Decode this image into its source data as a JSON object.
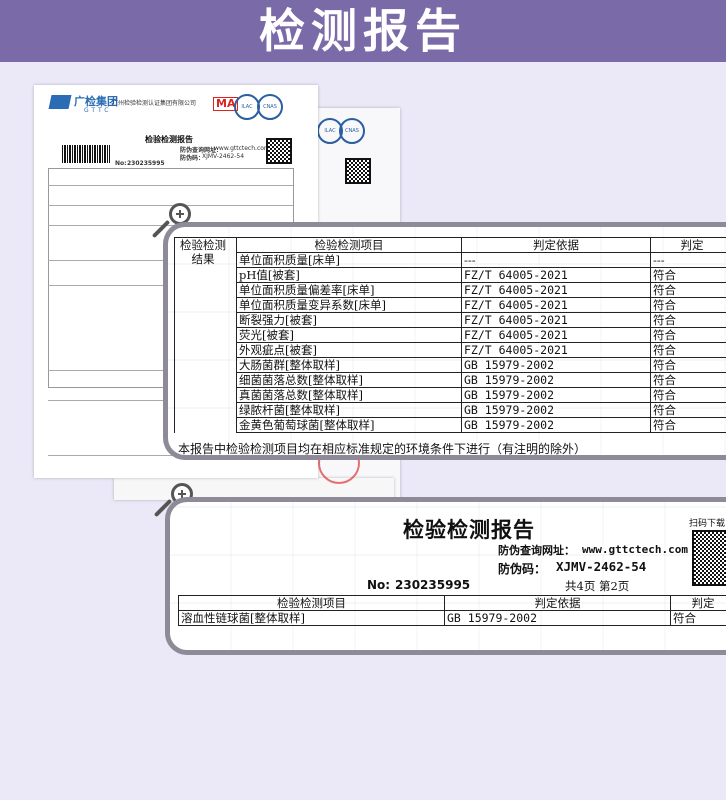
{
  "header": {
    "title": "检测报告"
  },
  "colors": {
    "header_bg": "#7b6aa8",
    "page_bg": "#ebe9f8",
    "zoom_border": "#8e8a97",
    "stamp": "#dd3333"
  },
  "background_doc": {
    "company": "广检集团",
    "company_en": "GTTC",
    "org": "广州检验检测认证集团有限公司",
    "ma_mark": "MA",
    "title": "检验检测报告",
    "url_label": "防伪查询网址：",
    "url": "www.gttctech.com",
    "code_label": "防伪码：",
    "code": "XJMV-2462-54",
    "no_label": "No:",
    "no": "230235995"
  },
  "zoom1": {
    "section_label": "检验检测结果",
    "headers": [
      "检验检测项目",
      "判定依据",
      "判定"
    ],
    "rows": [
      [
        "单位面积质量[床单]",
        "---",
        "---"
      ],
      [
        "pH值[被套]",
        "FZ/T 64005-2021",
        "符合"
      ],
      [
        "单位面积质量偏差率[床单]",
        "FZ/T 64005-2021",
        "符合"
      ],
      [
        "单位面积质量变异系数[床单]",
        "FZ/T 64005-2021",
        "符合"
      ],
      [
        "断裂强力[被套]",
        "FZ/T 64005-2021",
        "符合"
      ],
      [
        "荧光[被套]",
        "FZ/T 64005-2021",
        "符合"
      ],
      [
        "外观疵点[被套]",
        "FZ/T 64005-2021",
        "符合"
      ],
      [
        "大肠菌群[整体取样]",
        "GB 15979-2002",
        "符合"
      ],
      [
        "细菌菌落总数[整体取样]",
        "GB 15979-2002",
        "符合"
      ],
      [
        "真菌菌落总数[整体取样]",
        "GB 15979-2002",
        "符合"
      ],
      [
        "绿脓杆菌[整体取样]",
        "GB 15979-2002",
        "符合"
      ],
      [
        "金黄色葡萄球菌[整体取样]",
        "GB 15979-2002",
        "符合"
      ]
    ],
    "note": "本报告中检验检测项目均在相应标准规定的环境条件下进行（有注明的除外）"
  },
  "zoom2": {
    "title": "检验检测报告",
    "scan_label": "扫码下载",
    "url_label": "防伪查询网址：",
    "url": "www.gttctech.com",
    "code_label": "防伪码：",
    "code": "XJMV-2462-54",
    "no_label": "No:",
    "no": "230235995",
    "pages": "共4页 第2页",
    "headers": [
      "检验检测项目",
      "判定依据",
      "判定"
    ],
    "rows": [
      [
        "溶血性链球菌[整体取样]",
        "GB 15979-2002",
        "符合"
      ]
    ]
  }
}
